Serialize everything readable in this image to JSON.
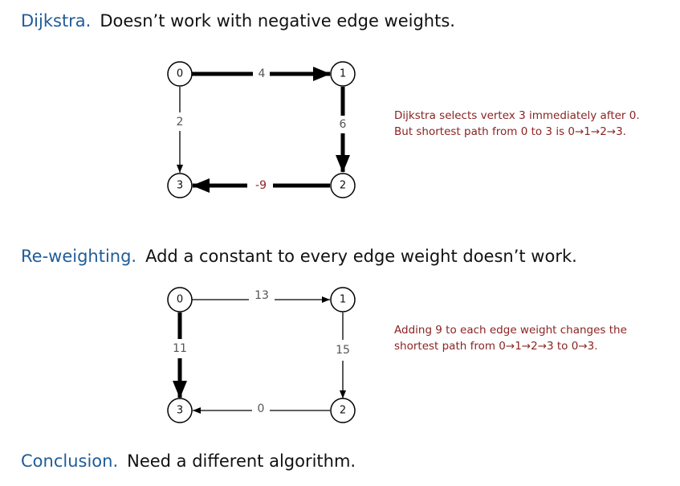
{
  "sections": [
    {
      "term": "Dijkstra.",
      "text": "Doesn’t work with negative edge weights.",
      "note_lines": [
        "Dijkstra selects vertex 3 immediately after 0.",
        "But shortest path from 0 to 3 is 0→1→2→3."
      ],
      "vertices": [
        "0",
        "1",
        "2",
        "3"
      ],
      "edges": [
        {
          "from": "0",
          "to": "1",
          "weight": "4",
          "bold": true
        },
        {
          "from": "1",
          "to": "2",
          "weight": "6",
          "bold": true
        },
        {
          "from": "2",
          "to": "3",
          "weight": "-9",
          "bold": true
        },
        {
          "from": "0",
          "to": "3",
          "weight": "2",
          "bold": false
        }
      ]
    },
    {
      "term": "Re-weighting.",
      "text": "Add a constant to every edge weight doesn’t work.",
      "note_lines": [
        "Adding 9 to each edge weight changes the",
        "shortest path from 0→1→2→3 to 0→3."
      ],
      "vertices": [
        "0",
        "1",
        "2",
        "3"
      ],
      "edges": [
        {
          "from": "0",
          "to": "1",
          "weight": "13",
          "bold": false
        },
        {
          "from": "1",
          "to": "2",
          "weight": "15",
          "bold": false
        },
        {
          "from": "2",
          "to": "3",
          "weight": "0",
          "bold": false
        },
        {
          "from": "0",
          "to": "3",
          "weight": "11",
          "bold": true
        }
      ]
    }
  ],
  "conclusion": {
    "term": "Conclusion.",
    "text": "Need a different algorithm."
  },
  "colors": {
    "term": "#1f5c99",
    "note": "#8b2323",
    "negative_weight": "#8b2323",
    "weight": "#555555"
  }
}
